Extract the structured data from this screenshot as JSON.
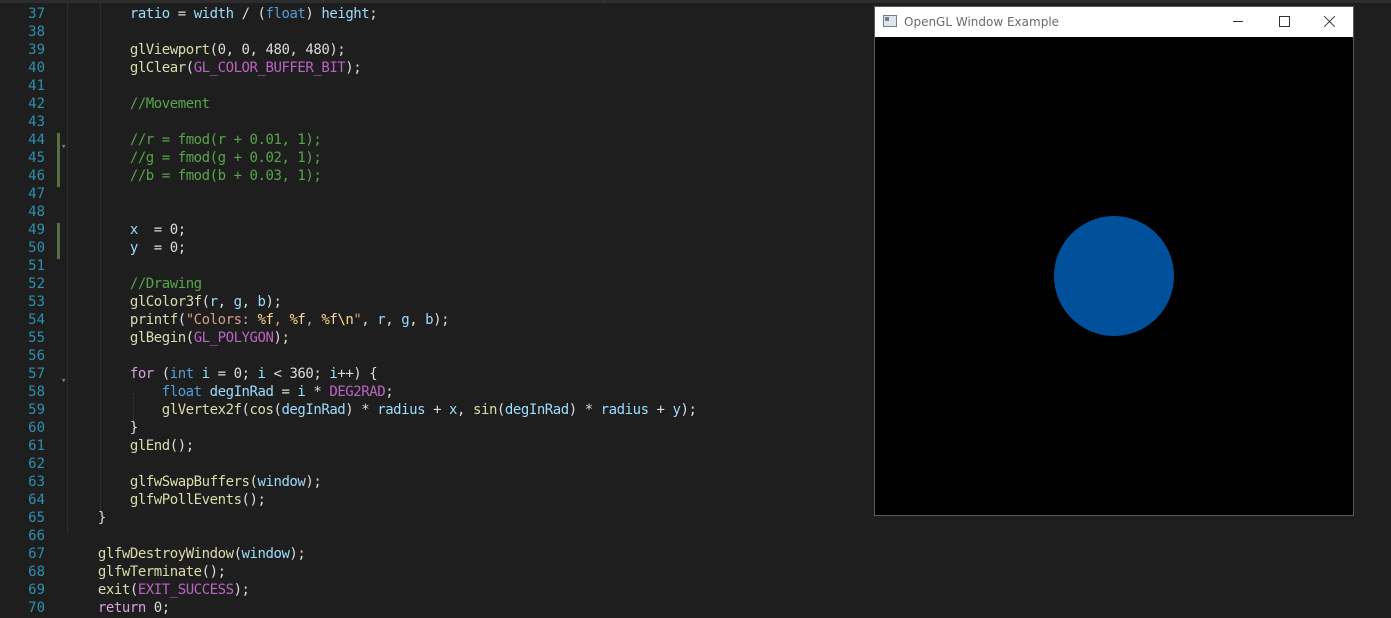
{
  "gl_window": {
    "title": "OpenGL Window Example",
    "circle_color": "#00509B",
    "background_color": "#000000"
  },
  "editor": {
    "lines": [
      {
        "n": "37",
        "tokens": [
          [
            "pl",
            "        "
          ],
          [
            "var",
            "ratio"
          ],
          [
            "pl",
            " = "
          ],
          [
            "var",
            "width"
          ],
          [
            "pl",
            " / ("
          ],
          [
            "kw",
            "float"
          ],
          [
            "pl",
            ") "
          ],
          [
            "var",
            "height"
          ],
          [
            "pl",
            ";"
          ]
        ]
      },
      {
        "n": "38",
        "tokens": []
      },
      {
        "n": "39",
        "tokens": [
          [
            "pl",
            "        "
          ],
          [
            "fn",
            "glViewport"
          ],
          [
            "pl",
            "(0, 0, 480, 480);"
          ]
        ]
      },
      {
        "n": "40",
        "tokens": [
          [
            "pl",
            "        "
          ],
          [
            "fn",
            "glClear"
          ],
          [
            "pl",
            "("
          ],
          [
            "mac",
            "GL_COLOR_BUFFER_BIT"
          ],
          [
            "pl",
            ");"
          ]
        ]
      },
      {
        "n": "41",
        "tokens": []
      },
      {
        "n": "42",
        "tokens": [
          [
            "pl",
            "        "
          ],
          [
            "com",
            "//Movement"
          ]
        ]
      },
      {
        "n": "43",
        "tokens": []
      },
      {
        "n": "44",
        "tokens": [
          [
            "pl",
            "        "
          ],
          [
            "com",
            "//r = fmod(r + 0.01, 1);"
          ]
        ]
      },
      {
        "n": "45",
        "tokens": [
          [
            "pl",
            "        "
          ],
          [
            "com",
            "//g = fmod(g + 0.02, 1);"
          ]
        ]
      },
      {
        "n": "46",
        "tokens": [
          [
            "pl",
            "        "
          ],
          [
            "com",
            "//b = fmod(b + 0.03, 1);"
          ]
        ]
      },
      {
        "n": "47",
        "tokens": []
      },
      {
        "n": "48",
        "tokens": []
      },
      {
        "n": "49",
        "tokens": [
          [
            "pl",
            "        "
          ],
          [
            "var",
            "x"
          ],
          [
            "pl",
            "  = 0;"
          ]
        ]
      },
      {
        "n": "50",
        "tokens": [
          [
            "pl",
            "        "
          ],
          [
            "var",
            "y"
          ],
          [
            "pl",
            "  = 0;"
          ]
        ]
      },
      {
        "n": "51",
        "tokens": []
      },
      {
        "n": "52",
        "tokens": [
          [
            "pl",
            "        "
          ],
          [
            "com",
            "//Drawing"
          ]
        ]
      },
      {
        "n": "53",
        "tokens": [
          [
            "pl",
            "        "
          ],
          [
            "fn",
            "glColor3f"
          ],
          [
            "pl",
            "("
          ],
          [
            "var",
            "r"
          ],
          [
            "pl",
            ", "
          ],
          [
            "var",
            "g"
          ],
          [
            "pl",
            ", "
          ],
          [
            "var",
            "b"
          ],
          [
            "pl",
            ");"
          ]
        ]
      },
      {
        "n": "54",
        "tokens": [
          [
            "pl",
            "        "
          ],
          [
            "fn",
            "printf"
          ],
          [
            "pl",
            "("
          ],
          [
            "str",
            "\"Colors: "
          ],
          [
            "esc",
            "%f"
          ],
          [
            "str",
            ", "
          ],
          [
            "esc",
            "%f"
          ],
          [
            "str",
            ", "
          ],
          [
            "esc",
            "%f\\n"
          ],
          [
            "str",
            "\""
          ],
          [
            "pl",
            ", "
          ],
          [
            "var",
            "r"
          ],
          [
            "pl",
            ", "
          ],
          [
            "var",
            "g"
          ],
          [
            "pl",
            ", "
          ],
          [
            "var",
            "b"
          ],
          [
            "pl",
            ");"
          ]
        ]
      },
      {
        "n": "55",
        "tokens": [
          [
            "pl",
            "        "
          ],
          [
            "fn",
            "glBegin"
          ],
          [
            "pl",
            "("
          ],
          [
            "mac",
            "GL_POLYGON"
          ],
          [
            "pl",
            ");"
          ]
        ]
      },
      {
        "n": "56",
        "tokens": []
      },
      {
        "n": "57",
        "tokens": [
          [
            "pl",
            "        "
          ],
          [
            "ctl",
            "for"
          ],
          [
            "pl",
            " ("
          ],
          [
            "kw",
            "int"
          ],
          [
            "pl",
            " "
          ],
          [
            "var",
            "i"
          ],
          [
            "pl",
            " = 0; "
          ],
          [
            "var",
            "i"
          ],
          [
            "pl",
            " < 360; "
          ],
          [
            "var",
            "i"
          ],
          [
            "pl",
            "++) {"
          ]
        ]
      },
      {
        "n": "58",
        "tokens": [
          [
            "pl",
            "            "
          ],
          [
            "kw",
            "float"
          ],
          [
            "pl",
            " "
          ],
          [
            "var",
            "degInRad"
          ],
          [
            "pl",
            " = "
          ],
          [
            "var",
            "i"
          ],
          [
            "pl",
            " * "
          ],
          [
            "mac",
            "DEG2RAD"
          ],
          [
            "pl",
            ";"
          ]
        ]
      },
      {
        "n": "59",
        "tokens": [
          [
            "pl",
            "            "
          ],
          [
            "fn",
            "glVertex2f"
          ],
          [
            "pl",
            "("
          ],
          [
            "fn",
            "cos"
          ],
          [
            "pl",
            "("
          ],
          [
            "var",
            "degInRad"
          ],
          [
            "pl",
            ") * "
          ],
          [
            "var",
            "radius"
          ],
          [
            "pl",
            " + "
          ],
          [
            "var",
            "x"
          ],
          [
            "pl",
            ", "
          ],
          [
            "fn",
            "sin"
          ],
          [
            "pl",
            "("
          ],
          [
            "var",
            "degInRad"
          ],
          [
            "pl",
            ") * "
          ],
          [
            "var",
            "radius"
          ],
          [
            "pl",
            " + "
          ],
          [
            "var",
            "y"
          ],
          [
            "pl",
            ");"
          ]
        ]
      },
      {
        "n": "60",
        "tokens": [
          [
            "pl",
            "        }"
          ]
        ]
      },
      {
        "n": "61",
        "tokens": [
          [
            "pl",
            "        "
          ],
          [
            "fn",
            "glEnd"
          ],
          [
            "pl",
            "();"
          ]
        ]
      },
      {
        "n": "62",
        "tokens": []
      },
      {
        "n": "63",
        "tokens": [
          [
            "pl",
            "        "
          ],
          [
            "fn",
            "glfwSwapBuffers"
          ],
          [
            "pl",
            "("
          ],
          [
            "var",
            "window"
          ],
          [
            "pl",
            ");"
          ]
        ]
      },
      {
        "n": "64",
        "tokens": [
          [
            "pl",
            "        "
          ],
          [
            "fn",
            "glfwPollEvents"
          ],
          [
            "pl",
            "();"
          ]
        ]
      },
      {
        "n": "65",
        "tokens": [
          [
            "pl",
            "    }"
          ]
        ]
      },
      {
        "n": "66",
        "tokens": []
      },
      {
        "n": "67",
        "tokens": [
          [
            "pl",
            "    "
          ],
          [
            "fn",
            "glfwDestroyWindow"
          ],
          [
            "pl",
            "("
          ],
          [
            "var",
            "window"
          ],
          [
            "pl",
            ");"
          ]
        ]
      },
      {
        "n": "68",
        "tokens": [
          [
            "pl",
            "    "
          ],
          [
            "fn",
            "glfwTerminate"
          ],
          [
            "pl",
            "();"
          ]
        ]
      },
      {
        "n": "69",
        "tokens": [
          [
            "pl",
            "    "
          ],
          [
            "fn",
            "exit"
          ],
          [
            "pl",
            "("
          ],
          [
            "mac",
            "EXIT_SUCCESS"
          ],
          [
            "pl",
            ");"
          ]
        ]
      },
      {
        "n": "70",
        "tokens": [
          [
            "pl",
            "    "
          ],
          [
            "ctl",
            "return"
          ],
          [
            "pl",
            " 0;"
          ]
        ]
      }
    ]
  }
}
